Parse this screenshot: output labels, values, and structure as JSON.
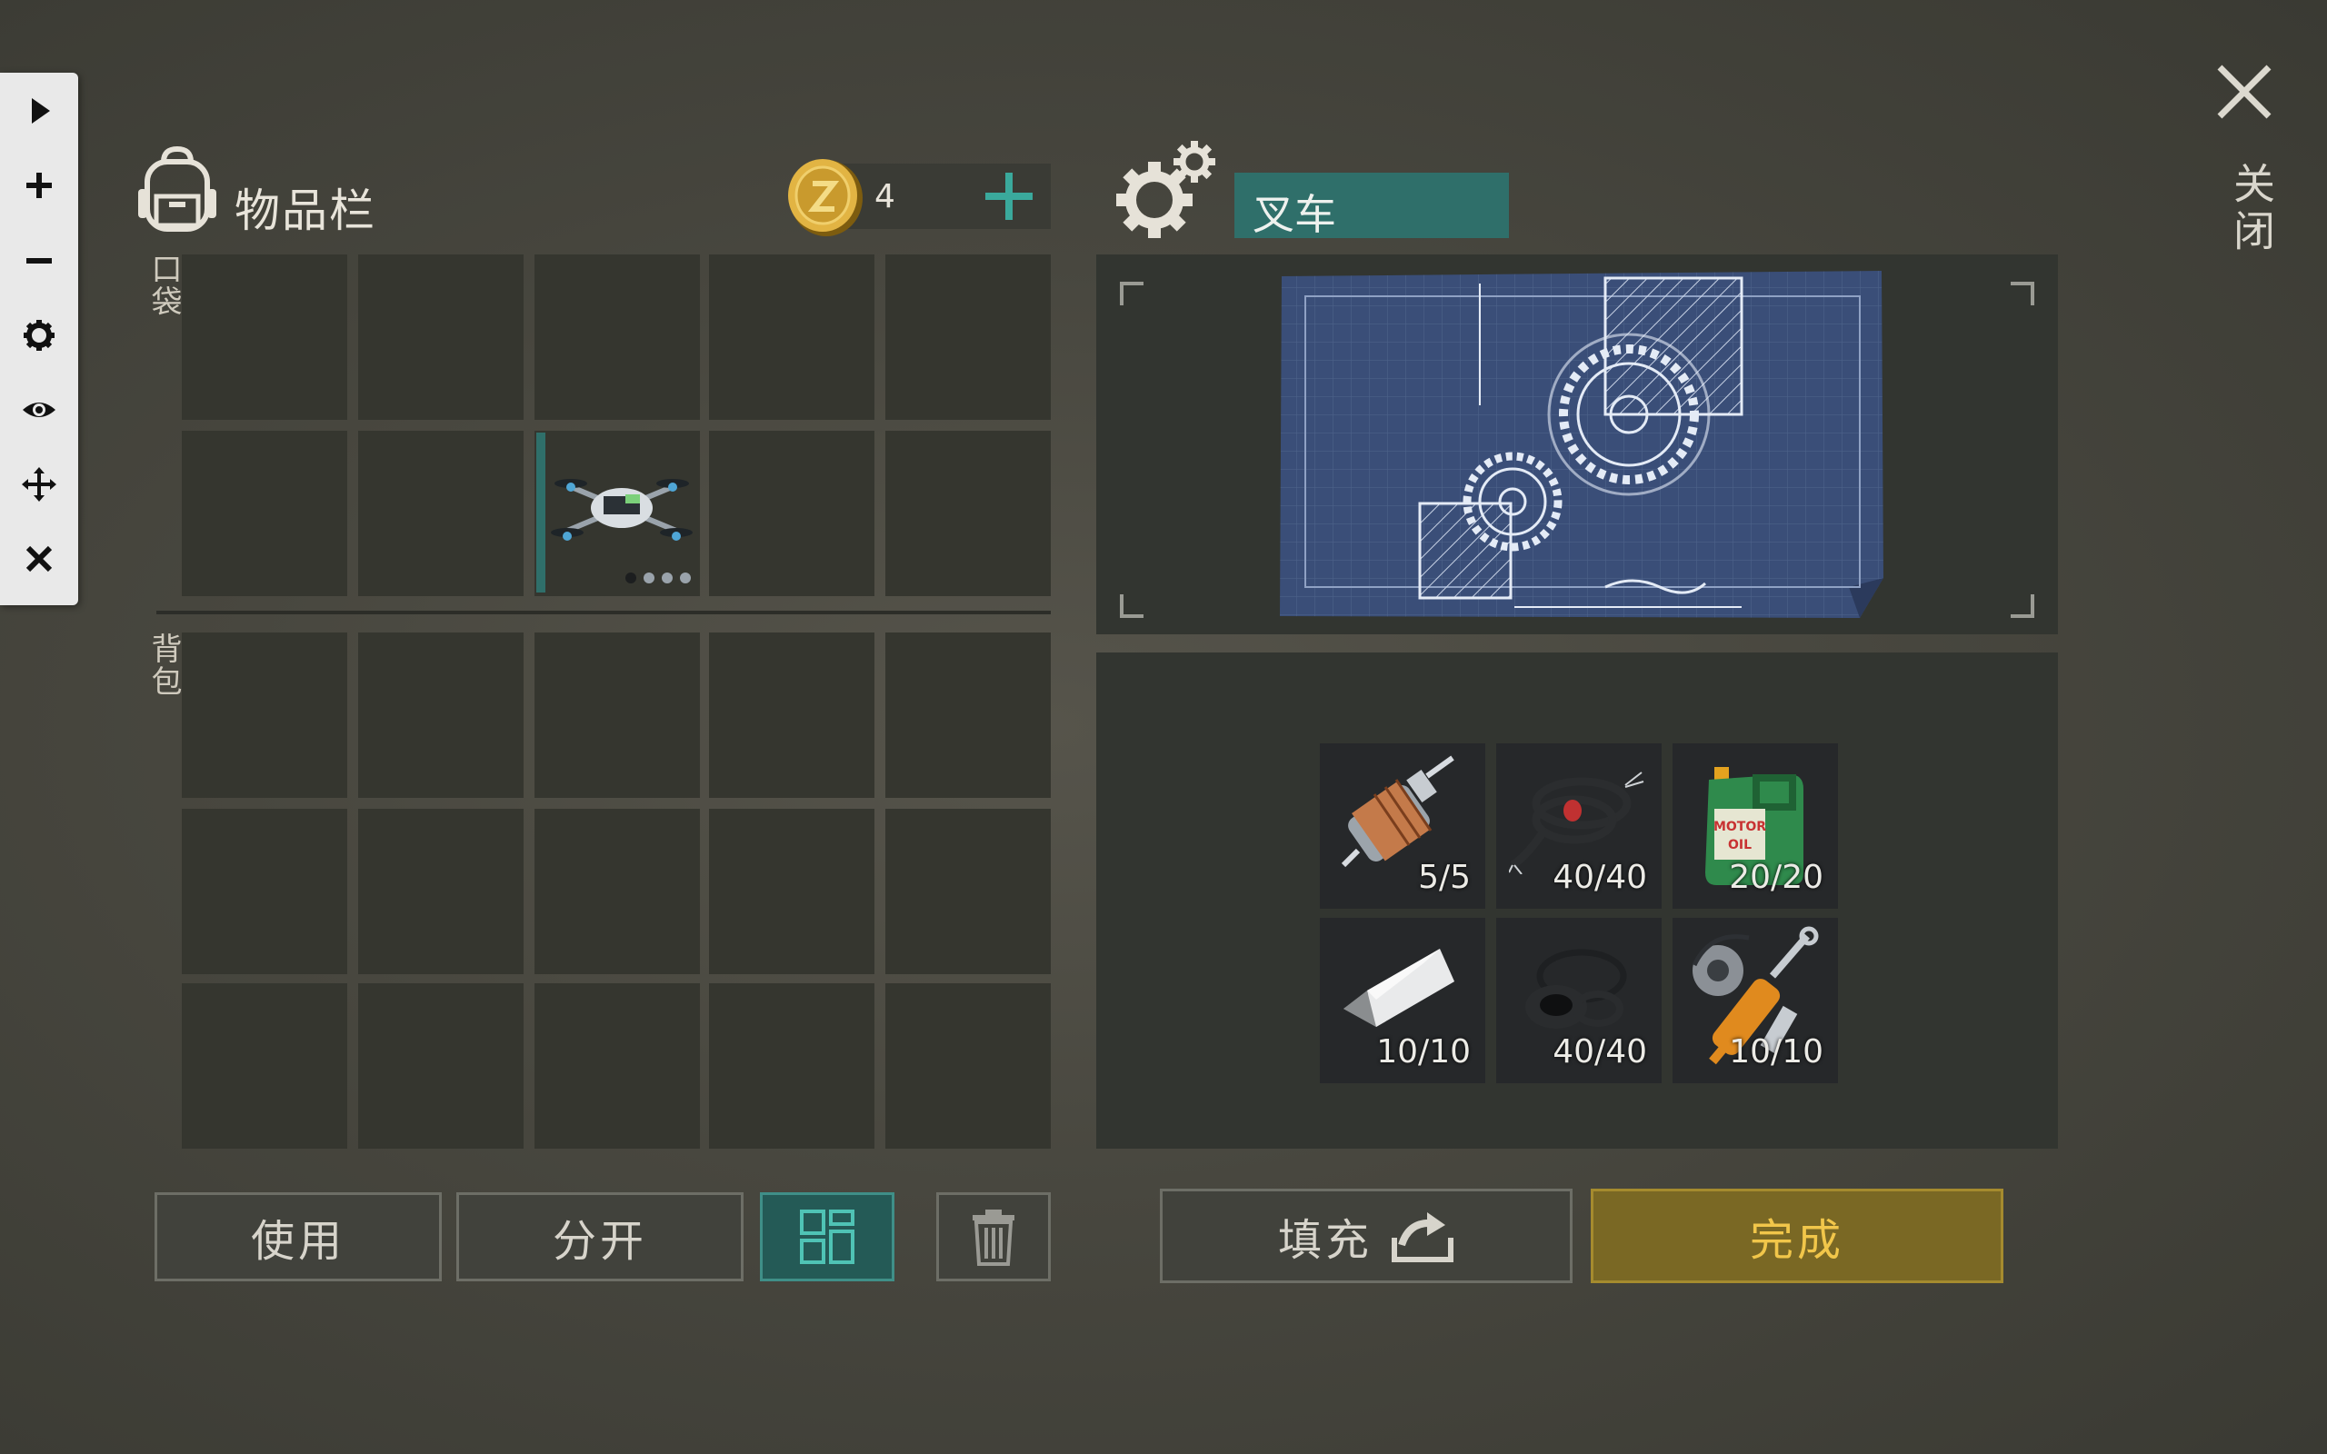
{
  "toolbar": {
    "icons": [
      "play-icon",
      "plus-icon",
      "minus-icon",
      "gear-icon",
      "eye-icon",
      "move-icon",
      "close-icon"
    ]
  },
  "inventory": {
    "title": "物品栏",
    "coins": "4",
    "pocket_label": "口袋",
    "backpack_label": "背包",
    "drone_item": {
      "name": "drone",
      "durability_dots": 4
    }
  },
  "craft": {
    "recipe_name": "叉车",
    "ingredients": [
      {
        "name": "electric-motor",
        "count": "5/5"
      },
      {
        "name": "wires",
        "count": "40/40"
      },
      {
        "name": "motor-oil",
        "count": "20/20"
      },
      {
        "name": "silver-ingot",
        "count": "10/10"
      },
      {
        "name": "rubber-seals",
        "count": "40/40"
      },
      {
        "name": "hydraulic-cylinder",
        "count": "10/10"
      }
    ]
  },
  "buttons": {
    "use": "使用",
    "split": "分开",
    "fill": "填充",
    "done": "完成",
    "close": "关闭"
  },
  "colors": {
    "accent_teal": "#2f6f6a",
    "done_gold": "#7a6824",
    "done_text": "#f1c64a",
    "blueprint": "#3a4e78"
  }
}
